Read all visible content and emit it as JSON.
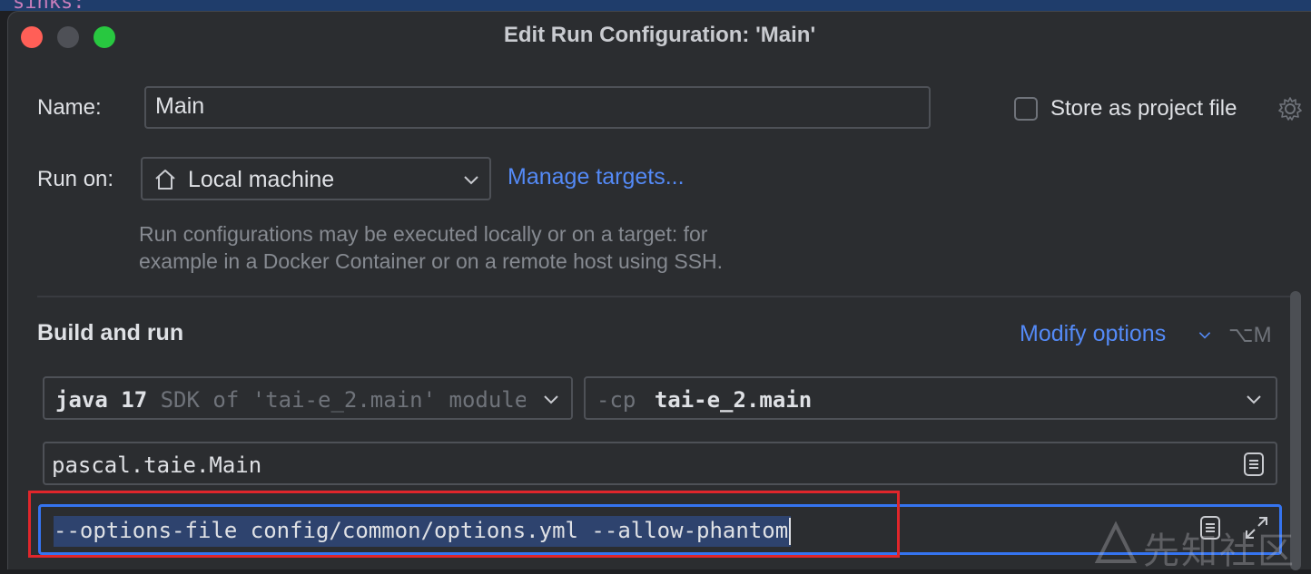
{
  "background": {
    "top_text": "sinks:"
  },
  "window": {
    "title": "Edit Run Configuration: 'Main'",
    "name_label": "Name:",
    "name_value": "Main",
    "store_label": "Store as project file",
    "run_on_label": "Run on:",
    "run_on_value": "Local machine",
    "manage_targets": "Manage targets...",
    "hint_line1": "Run configurations may be executed locally or on a target: for",
    "hint_line2": "example in a Docker Container or on a remote host using SSH.",
    "section_title": "Build and run",
    "modify_options": "Modify options",
    "modify_shortcut": "⌥M",
    "jdk_primary": "java 17",
    "jdk_secondary": "SDK of 'tai-e_2.main' module",
    "cp_flag": "-cp",
    "cp_value": "tai-e_2.main",
    "main_class": "pascal.taie.Main",
    "program_args": "--options-file config/common/options.yml --allow-phantom"
  },
  "watermark": {
    "text": "先知社区"
  },
  "colors": {
    "accent": "#548af7",
    "focus": "#3574f0",
    "highlight": "#e0262b",
    "close": "#ff5f57",
    "maximize": "#28c840"
  },
  "icons": [
    "home-icon",
    "chevron-down-icon",
    "gear-icon",
    "document-icon",
    "expand-icon"
  ]
}
